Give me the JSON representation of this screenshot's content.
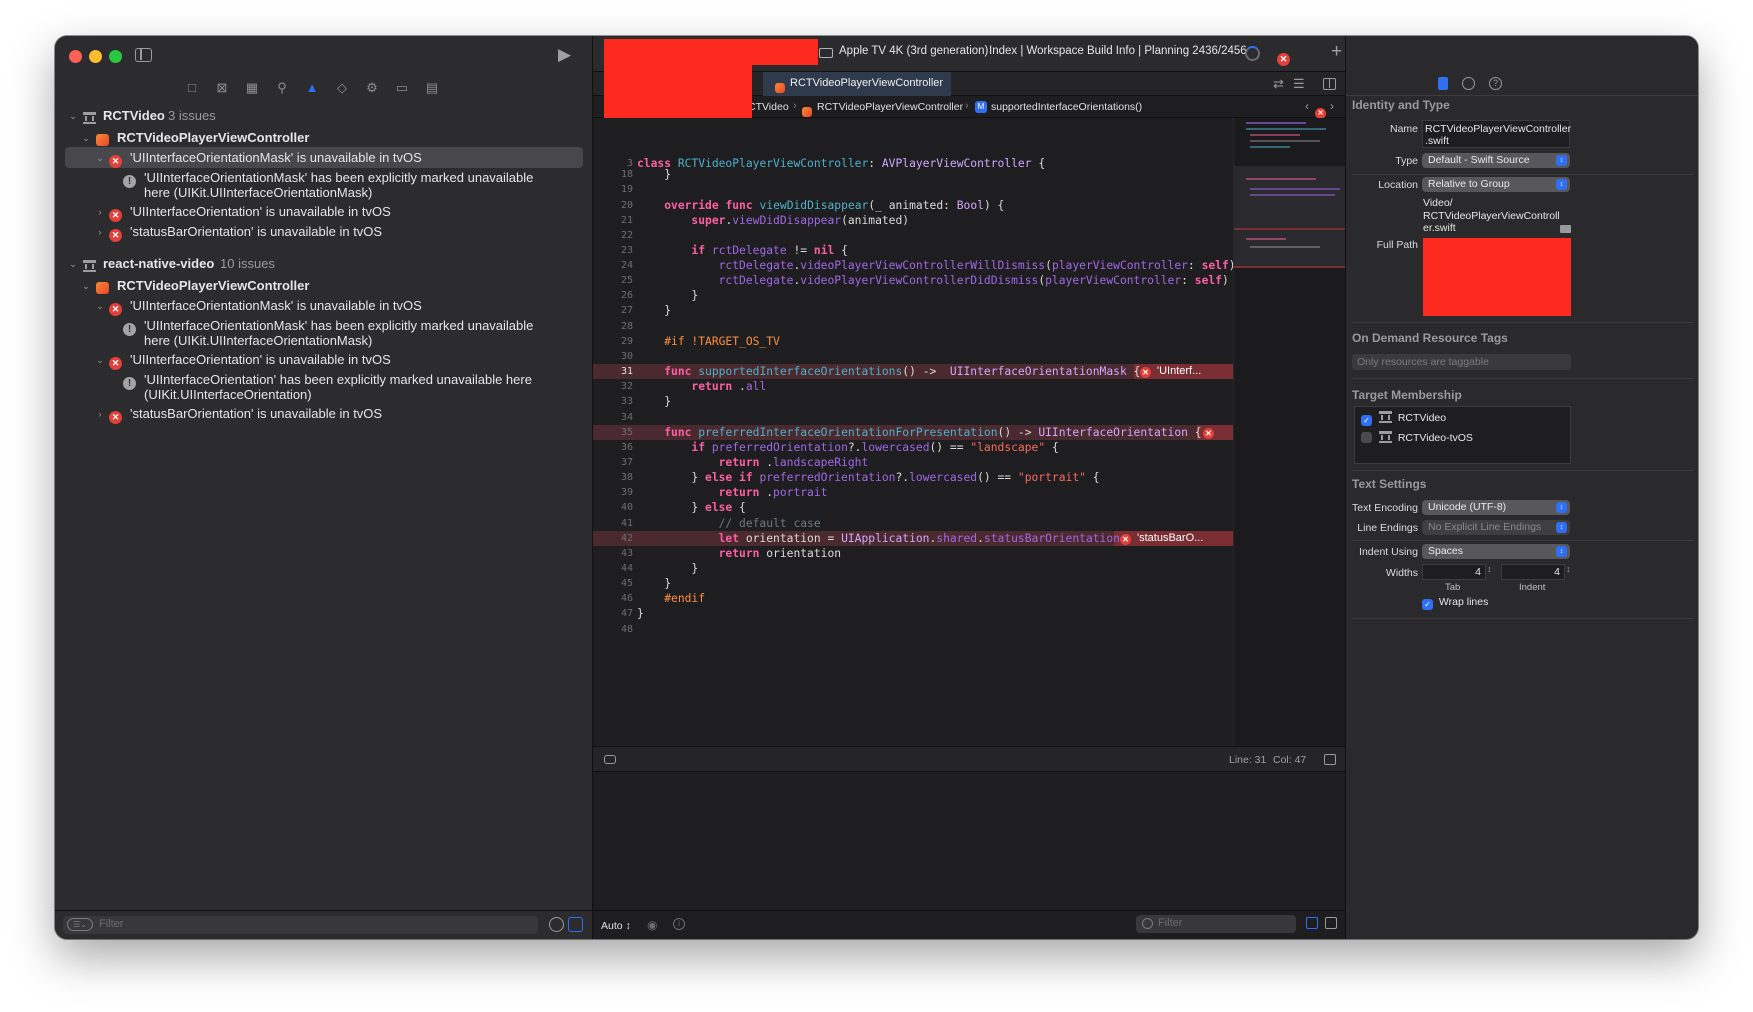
{
  "toolbar": {
    "device": "Apple TV 4K (3rd generation)",
    "status": "Index | Workspace Build Info | Planning 2436/2456"
  },
  "navigator": {
    "filter_placeholder": "Filter",
    "projects": [
      {
        "name": "RCTVideo",
        "count": "3 issues",
        "file": "RCTVideoPlayerViewController",
        "issues": [
          {
            "text": "'UIInterfaceOrientationMask' is unavailable in tvOS",
            "note_line1": "'UIInterfaceOrientationMask' has been explicitly marked unavailable",
            "note_line2": "here (UIKit.UIInterfaceOrientationMask)"
          },
          {
            "text": "'UIInterfaceOrientation' is unavailable in tvOS"
          },
          {
            "text": "'statusBarOrientation' is unavailable in tvOS"
          }
        ]
      },
      {
        "name": "react-native-video",
        "count": "10 issues",
        "file": "RCTVideoPlayerViewController",
        "issues": [
          {
            "text": "'UIInterfaceOrientationMask' is unavailable in tvOS",
            "note_line1": "'UIInterfaceOrientationMask' has been explicitly marked unavailable",
            "note_line2": "here (UIKit.UIInterfaceOrientationMask)"
          },
          {
            "text": "'UIInterfaceOrientation' is unavailable in tvOS",
            "note_line1": "'UIInterfaceOrientation' has been explicitly marked unavailable here",
            "note_line2": "(UIKit.UIInterfaceOrientation)"
          },
          {
            "text": "'statusBarOrientation' is unavailable in tvOS"
          }
        ]
      }
    ]
  },
  "editor": {
    "tab": "RCTVideoPlayerViewController",
    "breadcrumb": [
      "CTVideo",
      "RCTVideoPlayerViewController",
      "supportedInterfaceOrientations()"
    ],
    "breadcrumb_badge": "M",
    "line_numbers": [
      "3",
      "18",
      "19",
      "20",
      "21",
      "22",
      "23",
      "24",
      "25",
      "26",
      "27",
      "28",
      "29",
      "30",
      "31",
      "32",
      "33",
      "34",
      "35",
      "36",
      "37",
      "38",
      "39",
      "40",
      "41",
      "42",
      "43",
      "44",
      "45",
      "46",
      "47",
      "48"
    ],
    "error_labels": {
      "line31": "'UInterf...",
      "line42": "'statusBarO..."
    },
    "status": {
      "line": "Line: 31",
      "col": "Col: 47"
    }
  },
  "debug_bar": {
    "mode": "Auto ↕",
    "filter_placeholder": "Filter"
  },
  "inspector": {
    "identity_title": "Identity and Type",
    "name_label": "Name",
    "name_value_line1": "RCTVideoPlayerViewController",
    "name_value_line2": ".swift",
    "type_label": "Type",
    "type_value": "Default - Swift Source",
    "location_label": "Location",
    "location_value": "Relative to Group",
    "location_path_line1": "Video/",
    "location_path_line2": "RCTVideoPlayerViewControll",
    "location_path_line3": "er.swift",
    "full_path_label": "Full Path",
    "odr_title": "On Demand Resource Tags",
    "odr_placeholder": "Only resources are taggable",
    "target_title": "Target Membership",
    "targets": [
      {
        "name": "RCTVideo",
        "checked": true
      },
      {
        "name": "RCTVideo-tvOS",
        "checked": false
      }
    ],
    "text_title": "Text Settings",
    "encoding_label": "Text Encoding",
    "encoding_value": "Unicode (UTF-8)",
    "line_endings_label": "Line Endings",
    "line_endings_value": "No Explicit Line Endings",
    "indent_label": "Indent Using",
    "indent_value": "Spaces",
    "widths_label": "Widths",
    "tab_width": "4",
    "indent_width": "4",
    "tab_caption": "Tab",
    "indent_caption": "Indent",
    "wrap_label": "Wrap lines"
  },
  "colors": {
    "error": "#e2413a",
    "accent": "#2f6ff2",
    "redacted": "#ff2a1f"
  }
}
